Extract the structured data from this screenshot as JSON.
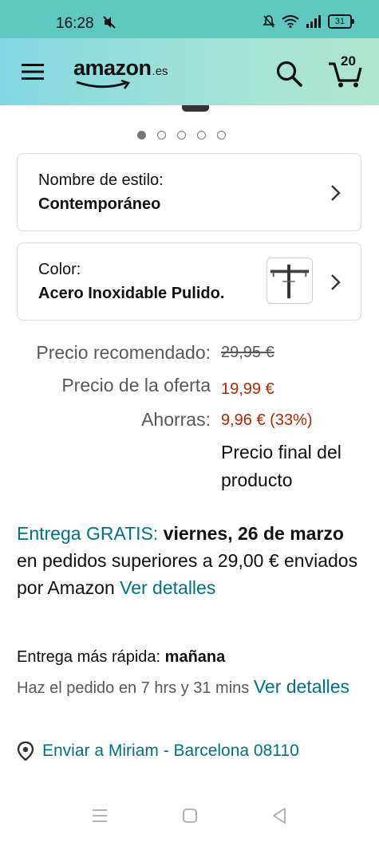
{
  "status_bar": {
    "time": "16:28",
    "battery": "31"
  },
  "header": {
    "logo_word": "amazon",
    "logo_tld": ".es",
    "cart_count": "20"
  },
  "carousel": {
    "total_dots": 5,
    "active_index": 0
  },
  "style_option": {
    "label": "Nombre de estilo:",
    "value": "Contemporáneo"
  },
  "color_option": {
    "label": "Color:",
    "value": "Acero Inoxidable Pulido."
  },
  "pricing": {
    "recommended_label": "Precio recomendado:",
    "recommended_value": "29,95 €",
    "offer_label": "Precio de la oferta",
    "offer_value": "19,99 €",
    "savings_label": "Ahorras:",
    "savings_value": "9,96 € (33%)",
    "final_note": "Precio final del producto"
  },
  "delivery": {
    "free_label": "Entrega GRATIS:",
    "date": "viernes, 26 de marzo",
    "text": "en pedidos superiores a 29,00 € enviados por Amazon",
    "details_link": "Ver detalles"
  },
  "fastest": {
    "label": "Entrega más rápida:",
    "when": "mañana",
    "order_text": "Haz el pedido en 7 hrs y 31 mins",
    "details_link": "Ver detalles"
  },
  "ship_to": {
    "text": "Enviar a Miriam - Barcelona 08110"
  },
  "colors": {
    "teal": "#007185",
    "price_red": "#b12704"
  }
}
